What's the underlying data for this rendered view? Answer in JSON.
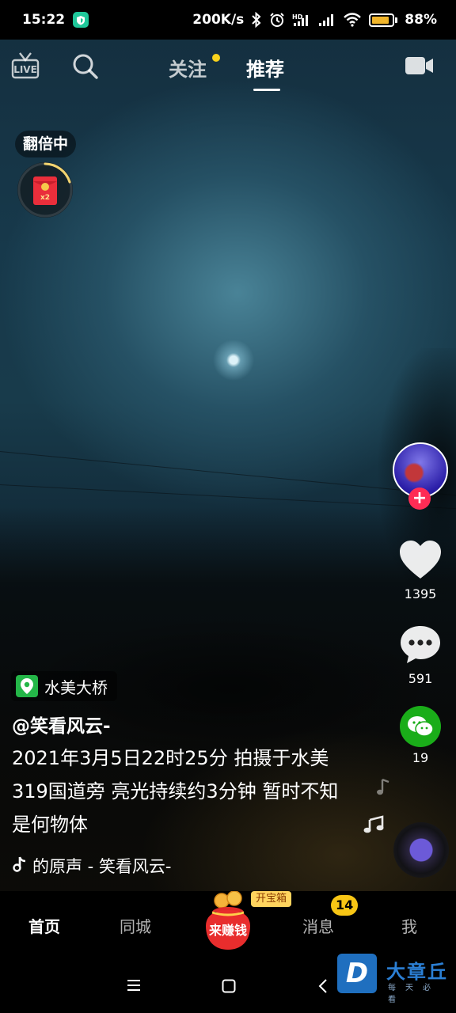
{
  "status_bar": {
    "time": "15:22",
    "net_speed": "200K/s",
    "battery_percent": "88%",
    "battery_level": 0.88,
    "icons": [
      "shield-icon",
      "bluetooth-icon",
      "alarm-icon",
      "hd-signal-icon",
      "signal-icon",
      "wifi-icon",
      "battery-icon"
    ]
  },
  "top_nav": {
    "live_icon": "live-icon",
    "search_icon": "search-icon",
    "tabs": [
      {
        "label": "关注",
        "active": false,
        "has_dot": true
      },
      {
        "label": "推荐",
        "active": true
      }
    ],
    "camera_icon": "camera-icon",
    "dot_color": "#f8d21c"
  },
  "promo": {
    "badge": "翻倍中",
    "redpacket_label": "x2",
    "progress": 0.3
  },
  "side_actions": {
    "follow_symbol": "+",
    "likes": "1395",
    "comments": "591",
    "shares": "19",
    "accent_color": "#fe2c55",
    "share_color": "#1aad19"
  },
  "video_info": {
    "location": "水美大桥",
    "author": "@笑看风云-",
    "caption": "2021年3月5日22时25分 拍摄于水美319国道旁 亮光持续约3分钟 暂时不知是何物体",
    "music": "的原声 - 笑看风云-"
  },
  "bottom_nav": {
    "items": [
      {
        "label": "首页",
        "active": true
      },
      {
        "label": "同城"
      },
      {
        "label": "消息"
      },
      {
        "label": "我"
      }
    ],
    "earn_label": "来赚钱",
    "treasure_tag": "开宝箱",
    "message_badge": "14",
    "badge_color": "#f8c615"
  },
  "watermark": {
    "logo": "D",
    "title": "大章丘",
    "subtitle": "每天必看"
  }
}
